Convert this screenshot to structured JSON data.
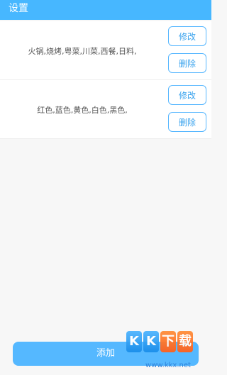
{
  "header": {
    "title": "设置"
  },
  "items": [
    {
      "text": "火锅,烧烤,粤菜,川菜,西餐,日料,",
      "edit_label": "修改",
      "delete_label": "删除"
    },
    {
      "text": "红色,蓝色,黄色,白色,黑色,",
      "edit_label": "修改",
      "delete_label": "删除"
    }
  ],
  "footer": {
    "add_label": "添加"
  },
  "watermark": {
    "text": "KK下载",
    "url": "www.kkx.net"
  },
  "colors": {
    "primary": "#47b7ff",
    "button_border": "#59b8ff",
    "background": "#f7f7f7"
  }
}
